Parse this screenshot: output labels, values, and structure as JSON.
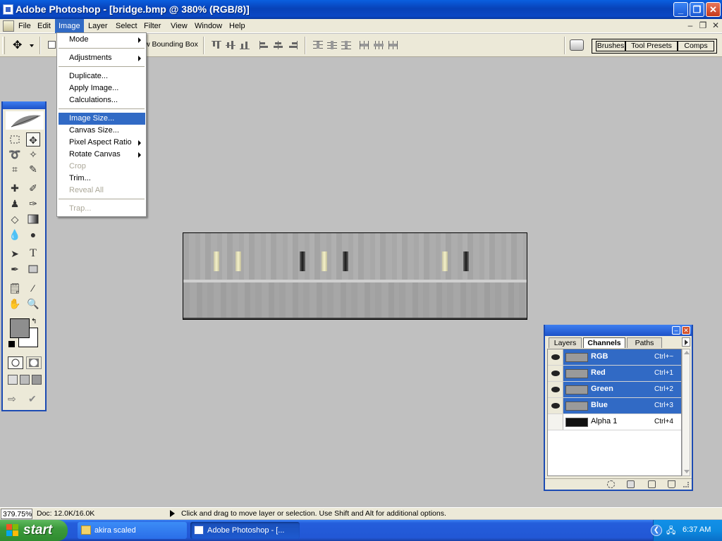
{
  "window": {
    "title": "Adobe Photoshop - [bridge.bmp @ 380% (RGB/8)]",
    "buttons": {
      "minimize": "_",
      "restore": "❐",
      "close": "✕"
    }
  },
  "menubar": {
    "items": [
      "File",
      "Edit",
      "Image",
      "Layer",
      "Select",
      "Filter",
      "View",
      "Window",
      "Help"
    ],
    "active": "Image",
    "doc_buttons": {
      "minimize": "–",
      "restore": "❐",
      "close": "✕"
    }
  },
  "options_bar": {
    "bounding_box_label": "w Bounding Box",
    "palette_well": {
      "tabs": [
        "Brushes",
        "Tool Presets",
        "Comps"
      ]
    }
  },
  "image_menu": {
    "items": [
      {
        "label": "Mode",
        "submenu": true,
        "disabled": false
      },
      {
        "label": "Adjustments",
        "submenu": true,
        "disabled": false
      },
      {
        "label": "Duplicate...",
        "submenu": false,
        "disabled": false
      },
      {
        "label": "Apply Image...",
        "submenu": false,
        "disabled": false
      },
      {
        "label": "Calculations...",
        "submenu": false,
        "disabled": false
      },
      {
        "label": "Image Size...",
        "submenu": false,
        "disabled": false,
        "highlighted": true
      },
      {
        "label": "Canvas Size...",
        "submenu": false,
        "disabled": false
      },
      {
        "label": "Pixel Aspect Ratio",
        "submenu": true,
        "disabled": false
      },
      {
        "label": "Rotate Canvas",
        "submenu": true,
        "disabled": false
      },
      {
        "label": "Crop",
        "submenu": false,
        "disabled": true
      },
      {
        "label": "Trim...",
        "submenu": false,
        "disabled": false
      },
      {
        "label": "Reveal All",
        "submenu": false,
        "disabled": true
      },
      {
        "label": "Trap...",
        "submenu": false,
        "disabled": true
      }
    ]
  },
  "status_bar": {
    "zoom": "379.75%",
    "doc_size": "Doc: 12.0K/16.0K",
    "hint": "Click and drag to move layer or selection.  Use Shift and Alt for additional options."
  },
  "channels_palette": {
    "tabs": [
      "Layers",
      "Channels",
      "Paths"
    ],
    "active_tab": "Channels",
    "channels": [
      {
        "name": "RGB",
        "shortcut": "Ctrl+~",
        "visible": true,
        "selected": true
      },
      {
        "name": "Red",
        "shortcut": "Ctrl+1",
        "visible": true,
        "selected": true
      },
      {
        "name": "Green",
        "shortcut": "Ctrl+2",
        "visible": true,
        "selected": true
      },
      {
        "name": "Blue",
        "shortcut": "Ctrl+3",
        "visible": true,
        "selected": true
      },
      {
        "name": "Alpha 1",
        "shortcut": "Ctrl+4",
        "visible": false,
        "selected": false
      }
    ]
  },
  "taskbar": {
    "start_label": "start",
    "tasks": [
      {
        "label": "akira scaled",
        "active": false
      },
      {
        "label": "Adobe Photoshop - [...",
        "active": true
      }
    ],
    "clock": "6:37 AM"
  },
  "colors": {
    "accent": "#316ac5",
    "foreground_color": "#8e8e8e",
    "background_color": "#ffffff"
  }
}
